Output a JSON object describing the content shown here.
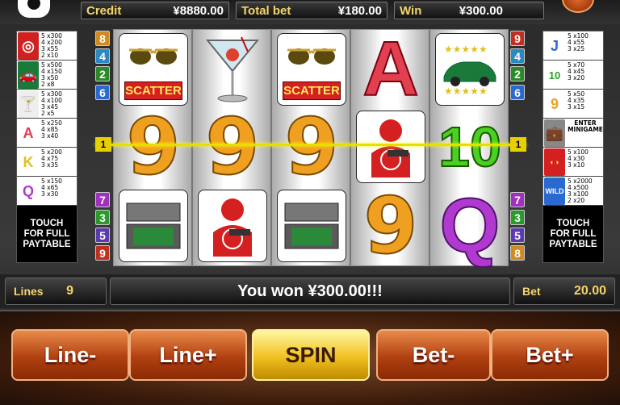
{
  "header": {
    "credit_label": "Credit",
    "credit_value": "¥8880.00",
    "totalbet_label": "Total bet",
    "totalbet_value": "¥180.00",
    "win_label": "Win",
    "win_value": "¥300.00"
  },
  "left_paytable": {
    "rows": [
      {
        "symbol": "target-icon",
        "text": "5 x300\n4 x200\n3 x55\n2 x10"
      },
      {
        "symbol": "car-icon",
        "text": "5 x500\n4 x150\n3 x50\n2 x8"
      },
      {
        "symbol": "martini-icon",
        "text": "5 x300\n4 x100\n3 x45\n2 x5"
      },
      {
        "symbol": "A",
        "text": "5 x250\n4 x85\n3 x40"
      },
      {
        "symbol": "K",
        "text": "5 x200\n4 x75\n3 x35"
      },
      {
        "symbol": "Q",
        "text": "5 x150\n4 x65\n3 x30"
      }
    ],
    "touch": "TOUCH\nFOR FULL\nPAYTABLE"
  },
  "right_paytable": {
    "rows": [
      {
        "symbol": "J",
        "text": "5 x100\n4 x55\n3 x25"
      },
      {
        "symbol": "10",
        "text": "5 x70\n4 x45\n3 x20"
      },
      {
        "symbol": "9",
        "text": "5 x50\n4 x35\n3 x15"
      },
      {
        "symbol": "briefcase-icon",
        "text": "ENTER\nMINIGAME"
      },
      {
        "symbol": "scatter-icon",
        "text": "5 x100\n4 x30\n3 x10"
      },
      {
        "symbol": "wild-icon",
        "text": "5 x2000\n4 x500\n3 x100\n2 x20"
      }
    ],
    "touch": "TOUCH\nFOR FULL\nPAYTABLE"
  },
  "left_lines": [
    "8",
    "4",
    "2",
    "6",
    "1",
    "7",
    "3",
    "5",
    "9"
  ],
  "right_lines": [
    "9",
    "4",
    "2",
    "6",
    "1",
    "7",
    "3",
    "5",
    "8"
  ],
  "colors": {
    "line_colors": [
      "#d08a20",
      "#2a8ac0",
      "#2a8a2a",
      "#2a6ad0",
      "#e6d000",
      "#a030c0",
      "#2a9a2a",
      "#5a3ab0",
      "#c03020"
    ]
  },
  "reels": [
    [
      "sunglasses-scatter",
      "9",
      "briefcase-icon"
    ],
    [
      "martini-icon",
      "9",
      "target-icon"
    ],
    [
      "sunglasses-scatter",
      "9",
      "briefcase-icon"
    ],
    [
      "A",
      "target-icon",
      "9"
    ],
    [
      "car-icon",
      "10",
      "Q"
    ]
  ],
  "scatter_label": "SCATTER",
  "payline_number": "1",
  "status": {
    "lines_label": "Lines",
    "lines_value": "9",
    "message": "You won ¥300.00!!!",
    "bet_label": "Bet",
    "bet_value": "20.00"
  },
  "buttons": {
    "line_minus": "Line-",
    "line_plus": "Line+",
    "spin": "SPIN",
    "bet_minus": "Bet-",
    "bet_plus": "Bet+"
  }
}
